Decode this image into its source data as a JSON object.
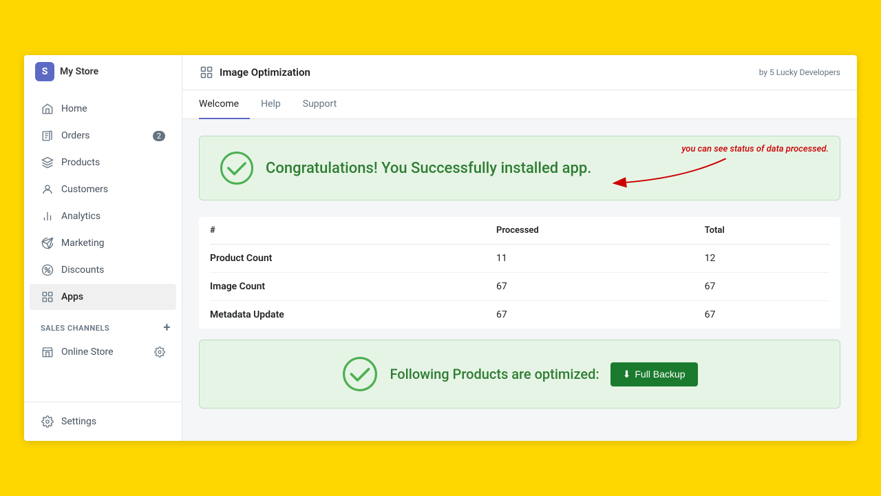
{
  "sidebar": {
    "logo": {
      "text": "My Store"
    },
    "nav": [
      {
        "id": "home",
        "label": "Home",
        "icon": "home"
      },
      {
        "id": "orders",
        "label": "Orders",
        "icon": "orders",
        "badge": "2"
      },
      {
        "id": "products",
        "label": "Products",
        "icon": "products"
      },
      {
        "id": "customers",
        "label": "Customers",
        "icon": "customers"
      },
      {
        "id": "analytics",
        "label": "Analytics",
        "icon": "analytics"
      },
      {
        "id": "marketing",
        "label": "Marketing",
        "icon": "marketing"
      },
      {
        "id": "discounts",
        "label": "Discounts",
        "icon": "discounts"
      },
      {
        "id": "apps",
        "label": "Apps",
        "icon": "apps",
        "active": true
      }
    ],
    "sales_channels_title": "SALES CHANNELS",
    "sales_channels": [
      {
        "id": "online-store",
        "label": "Online Store"
      }
    ],
    "settings_label": "Settings"
  },
  "header": {
    "icon": "grid",
    "title": "Image Optimization",
    "author": "by 5 Lucky Developers"
  },
  "tabs": [
    {
      "id": "welcome",
      "label": "Welcome",
      "active": true
    },
    {
      "id": "help",
      "label": "Help"
    },
    {
      "id": "support",
      "label": "Support"
    }
  ],
  "success_banner": {
    "message": "Congratulations! You Successfully installed app.",
    "annotation": "you can see status of data processed."
  },
  "table": {
    "columns": [
      "#",
      "Processed",
      "Total"
    ],
    "rows": [
      {
        "name": "Product Count",
        "processed": "11",
        "total": "12"
      },
      {
        "name": "Image Count",
        "processed": "67",
        "total": "67"
      },
      {
        "name": "Metadata Update",
        "processed": "67",
        "total": "67"
      }
    ]
  },
  "bottom_banner": {
    "message": "Following Products are optimized:",
    "button_label": "Full Backup",
    "button_icon": "download"
  }
}
